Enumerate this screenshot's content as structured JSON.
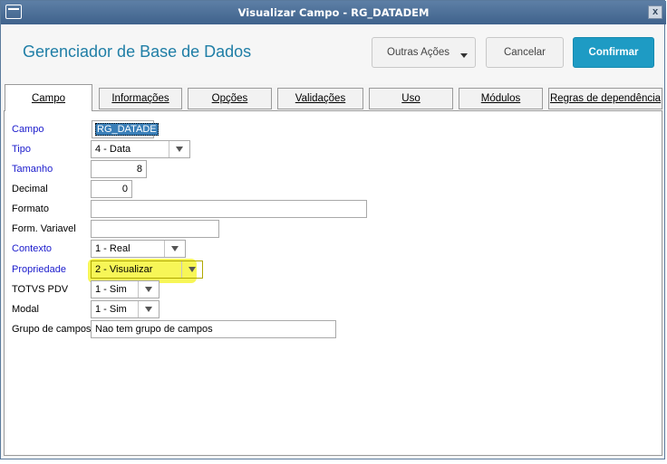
{
  "window": {
    "title": "Visualizar Campo - RG_DATADEM",
    "close_label": "x"
  },
  "header": {
    "title": "Gerenciador de Base de Dados",
    "more_actions_label": "Outras Ações",
    "cancel_label": "Cancelar",
    "confirm_label": "Confirmar"
  },
  "tabs": [
    "Campo",
    "Informações",
    "Opções",
    "Validações",
    "Uso",
    "Módulos",
    "Regras de dependência"
  ],
  "form": {
    "campo": {
      "label": "Campo",
      "value": "RG_DATADE"
    },
    "tipo": {
      "label": "Tipo",
      "value": "4 - Data"
    },
    "tamanho": {
      "label": "Tamanho",
      "value": "8"
    },
    "decimal": {
      "label": "Decimal",
      "value": "0"
    },
    "formato": {
      "label": "Formato",
      "value": ""
    },
    "form_variavel": {
      "label": "Form. Variavel",
      "value": ""
    },
    "contexto": {
      "label": "Contexto",
      "value": "1 - Real"
    },
    "propriedade": {
      "label": "Propriedade",
      "value": "2 - Visualizar"
    },
    "totvs_pdv": {
      "label": "TOTVS PDV",
      "value": "1 - Sim"
    },
    "modal": {
      "label": "Modal",
      "value": "1 - Sim"
    },
    "grupo_campos": {
      "label": "Grupo de campos",
      "value": "Nao tem grupo de campos"
    }
  },
  "colors": {
    "accent": "#1e9bc4",
    "title_text": "#1f7ea6",
    "label_blue": "#1a1acc",
    "highlight": "#f6f43a"
  }
}
